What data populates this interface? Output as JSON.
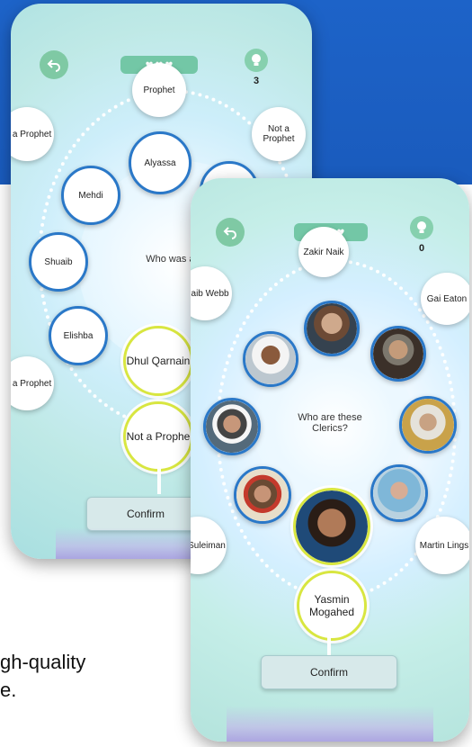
{
  "caption": {
    "line1": "gh-quality",
    "line2": "e."
  },
  "back_screen": {
    "hint_count": "3",
    "question": "Who was a proph",
    "answers": [
      "Prophet",
      "Not a Prophet",
      "ot a Prophet",
      "Alyassa",
      "Mehdi",
      "Shuaib",
      "Elishba",
      "ot a Prophet",
      "Dhul Qarnain",
      "Not a Prophe"
    ],
    "confirm_label": "Confirm",
    "icons": {
      "back": "back-arrow-icon",
      "hint": "lightbulb-icon",
      "lives": "heart-icon"
    }
  },
  "front_screen": {
    "hint_count": "0",
    "question": "Who are these Clerics?",
    "names": [
      "Zakir Naik",
      "uhaib Webb",
      "Gai Eaton",
      "mar Suleiman",
      "Martin Lings",
      "Yasmin Mogahed"
    ],
    "confirm_label": "Confirm",
    "icons": {
      "back": "back-arrow-icon",
      "hint": "lightbulb-icon",
      "lives": "heart-icon"
    }
  },
  "colors": {
    "band": "#1d63c8",
    "accent_green": "#7fc9a4",
    "border_blue": "#2a78c8",
    "border_yellow": "#d8e640"
  }
}
